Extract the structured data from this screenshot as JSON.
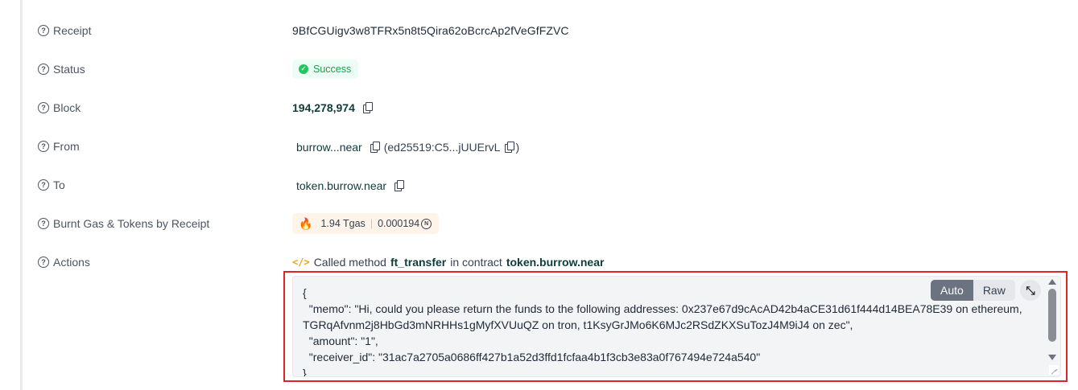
{
  "rows": {
    "receipt": {
      "label": "Receipt",
      "value": "9BfCGUigv3w8TFRx5n8t5Qira62oBcrcAp2fVeGfFZVC"
    },
    "status": {
      "label": "Status",
      "value": "Success"
    },
    "block": {
      "label": "Block",
      "value": "194,278,974"
    },
    "from": {
      "label": "From",
      "account": "burrow...near",
      "key_prefix": "(ed25519:C5...jUUErvL",
      "key_suffix": ")"
    },
    "to": {
      "label": "To",
      "account": "token.burrow.near"
    },
    "gas": {
      "label": "Burnt Gas & Tokens by Receipt",
      "gas": "1.94 Tgas",
      "separator": "|",
      "tokens": "0.000194"
    },
    "actions": {
      "label": "Actions",
      "icon_text": "</>",
      "prefix": "Called method",
      "method": "ft_transfer",
      "middle": "in contract",
      "contract": "token.burrow.near"
    }
  },
  "code_view": {
    "mode_auto": "Auto",
    "mode_raw": "Raw",
    "selected_mode": "Auto",
    "content": "{\n  \"memo\": \"Hi, could you please return the funds to the following addresses: 0x237e67d9cAcAD42b4aCE31d61f444d14BEA78E39 on ethereum, TGRqAfvnm2j8HbGd3mNRHHs1gMyfXVUuQZ on tron, t1KsyGrJMo6K6MJc2RSdZKXSuTozJ4M9iJ4 on zec\",\n  \"amount\": \"1\",\n  \"receiver_id\": \"31ac7a2705a0686ff427b1a52d3ffd1fcfaa4b1f3cb3e83a0f767494e724a540\"\n}"
  },
  "icons": {
    "help": "question-circle-icon",
    "success": "check-circle-icon",
    "copy": "copy-icon",
    "fire": "fire-icon",
    "near": "near-token-icon",
    "code": "code-icon",
    "collapse": "collapse-arrows-icon"
  },
  "colors": {
    "success_text": "#16a34a",
    "success_bg": "#ecfdf5",
    "link": "#0f3b3a",
    "highlight_border": "#dc2626",
    "code_bg": "#f3f4f6",
    "gas_bg": "#fff4ea"
  }
}
